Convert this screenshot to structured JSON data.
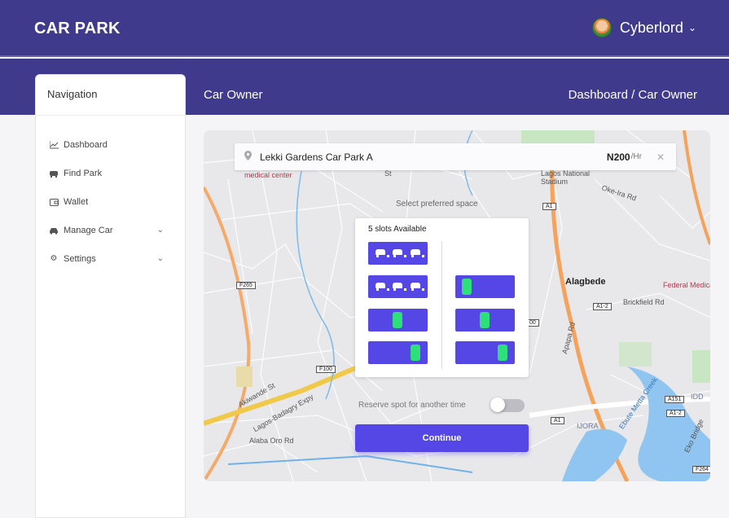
{
  "header": {
    "brand": "CAR PARK",
    "user_name": "Cyberlord"
  },
  "band": {
    "title": "Car Owner",
    "breadcrumb": "Dashboard / Car Owner"
  },
  "sidebar": {
    "heading": "Navigation",
    "items": [
      {
        "label": "Dashboard",
        "icon": "chart-line-icon"
      },
      {
        "label": "Find Park",
        "icon": "car-front-icon"
      },
      {
        "label": "Wallet",
        "icon": "wallet-icon"
      },
      {
        "label": "Manage Car",
        "icon": "car-icon",
        "expandable": true
      },
      {
        "label": "Settings",
        "icon": "gear-icon",
        "expandable": true
      }
    ]
  },
  "map": {
    "labels": {
      "medical_center": "medical center",
      "st": "St",
      "national_stadium": "Lagos National Stadium",
      "oke_ira": "Oke-Ira Rd",
      "alagbede": "Alagbede",
      "federal_medical": "Federal Medica",
      "brickfield": "Brickfield Rd",
      "apapa": "Apapa Rd",
      "akiwande": "Akiwande St",
      "badagry": "Lagos-Badagry Expy",
      "alaba": "Alaba Oro Rd",
      "ijora": "IJORA",
      "ebute": "Ebute Metta Creek",
      "eko_bridge": "Eko Bridge",
      "idd": "IDD"
    },
    "shields": [
      "F265",
      "F100",
      "A1",
      "A1",
      "A1-2",
      "A1-2",
      "A1",
      "A151",
      "F264",
      "00"
    ]
  },
  "booking": {
    "park_name": "Lekki Gardens Car Park A",
    "price": "N200",
    "unit": "/Hr",
    "hint": "Select preferred space",
    "slots_title": "5 slots Available",
    "reserve_label": "Reserve spot for another time",
    "reserve_on": false,
    "continue_label": "Continue"
  },
  "colors": {
    "primary": "#3f3a8c",
    "accent": "#5447e5",
    "occupied": "#2ee07a"
  }
}
